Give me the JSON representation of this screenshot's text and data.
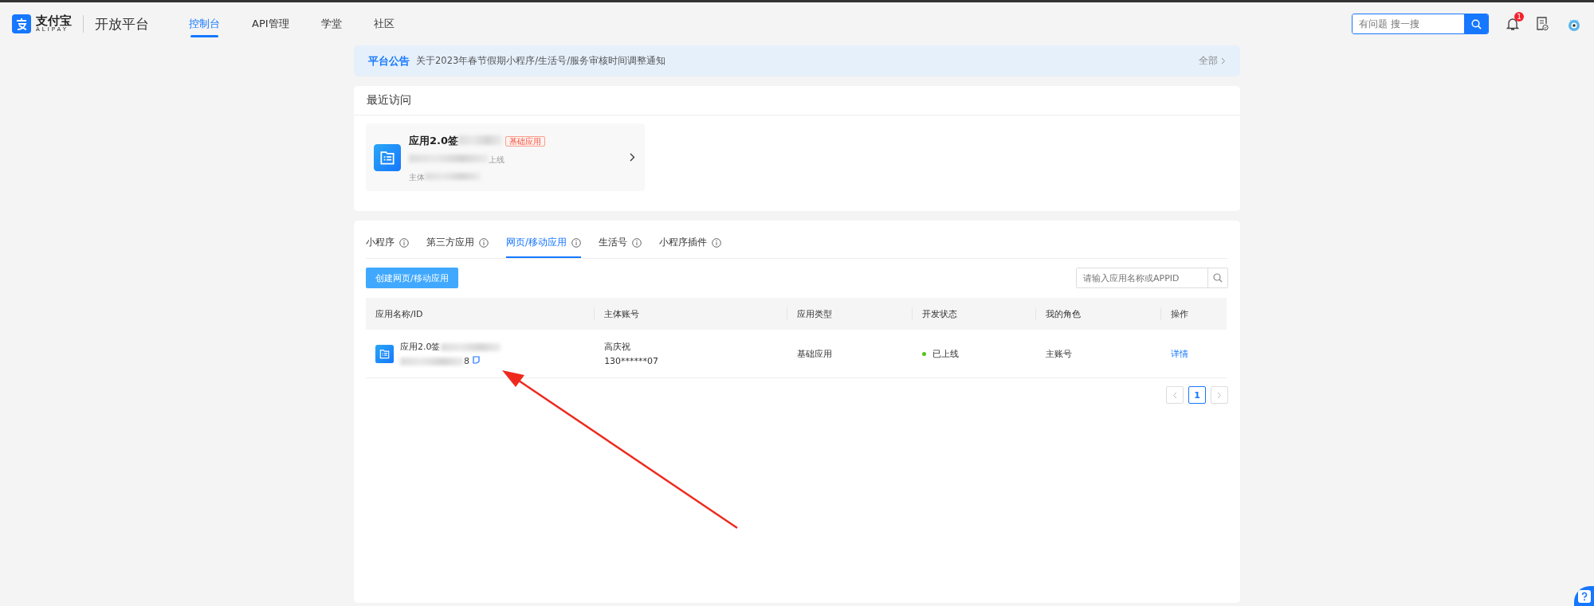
{
  "header": {
    "logo_text": "支付宝",
    "logo_sub": "ALIPAY",
    "platform": "开放平台",
    "nav": [
      {
        "label": "控制台",
        "selected": true
      },
      {
        "label": "API管理",
        "selected": false
      },
      {
        "label": "学堂",
        "selected": false
      },
      {
        "label": "社区",
        "selected": false
      }
    ],
    "search": {
      "placeholder": "有问题 搜一搜"
    },
    "notification_count": "1"
  },
  "notice": {
    "tag": "平台公告",
    "text": "关于2023年春节假期小程序/生活号/服务审核时间调整通知",
    "more": "全部"
  },
  "recent": {
    "title": "最近访问",
    "items": [
      {
        "name": "应用2.0签",
        "badge": "基础应用",
        "status": "上线",
        "owner_label": "主体"
      }
    ]
  },
  "apps": {
    "tabs": [
      {
        "label": "小程序",
        "selected": false
      },
      {
        "label": "第三方应用",
        "selected": false
      },
      {
        "label": "网页/移动应用",
        "selected": true
      },
      {
        "label": "生活号",
        "selected": false
      },
      {
        "label": "小程序插件",
        "selected": false
      }
    ],
    "create_button": "创建网页/移动应用",
    "search": {
      "placeholder": "请输入应用名称或APPID"
    },
    "table": {
      "columns": [
        "应用名称/ID",
        "主体账号",
        "应用类型",
        "开发状态",
        "我的角色",
        "操作"
      ],
      "rows": [
        {
          "name": "应用2.0签",
          "id_suffix": "8",
          "owner_name": "高庆祝",
          "owner_account": "130******07",
          "type": "基础应用",
          "status": "已上线",
          "color": "#52c41a",
          "role": "主账号",
          "action": "详情"
        }
      ]
    },
    "pagination": {
      "pages": [
        {
          "label": "1",
          "selected": true
        }
      ]
    }
  }
}
